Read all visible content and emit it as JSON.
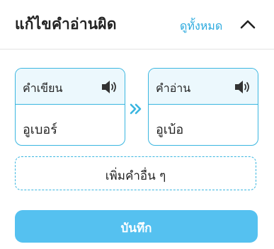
{
  "header": {
    "title": "แก้ไขคำอ่านผิด",
    "view_all": "ดูทั้งหมด",
    "collapse_icon": "chevron-up-icon"
  },
  "written_card": {
    "label": "คำเขียน",
    "value": "อูเบอร์",
    "speaker_icon": "speaker-icon"
  },
  "reading_card": {
    "label": "คำอ่าน",
    "value": "อูเบ้อ",
    "speaker_icon": "speaker-icon"
  },
  "arrow_icon": "double-chevron-right-icon",
  "add_more_label": "เพิ่มคำอื่น ๆ",
  "save_label": "บันทึก",
  "colors": {
    "accent": "#3ab6e0",
    "link": "#2aa9de",
    "button": "#55c1f0",
    "card_header_bg": "#ecf8fd",
    "text": "#222222"
  }
}
